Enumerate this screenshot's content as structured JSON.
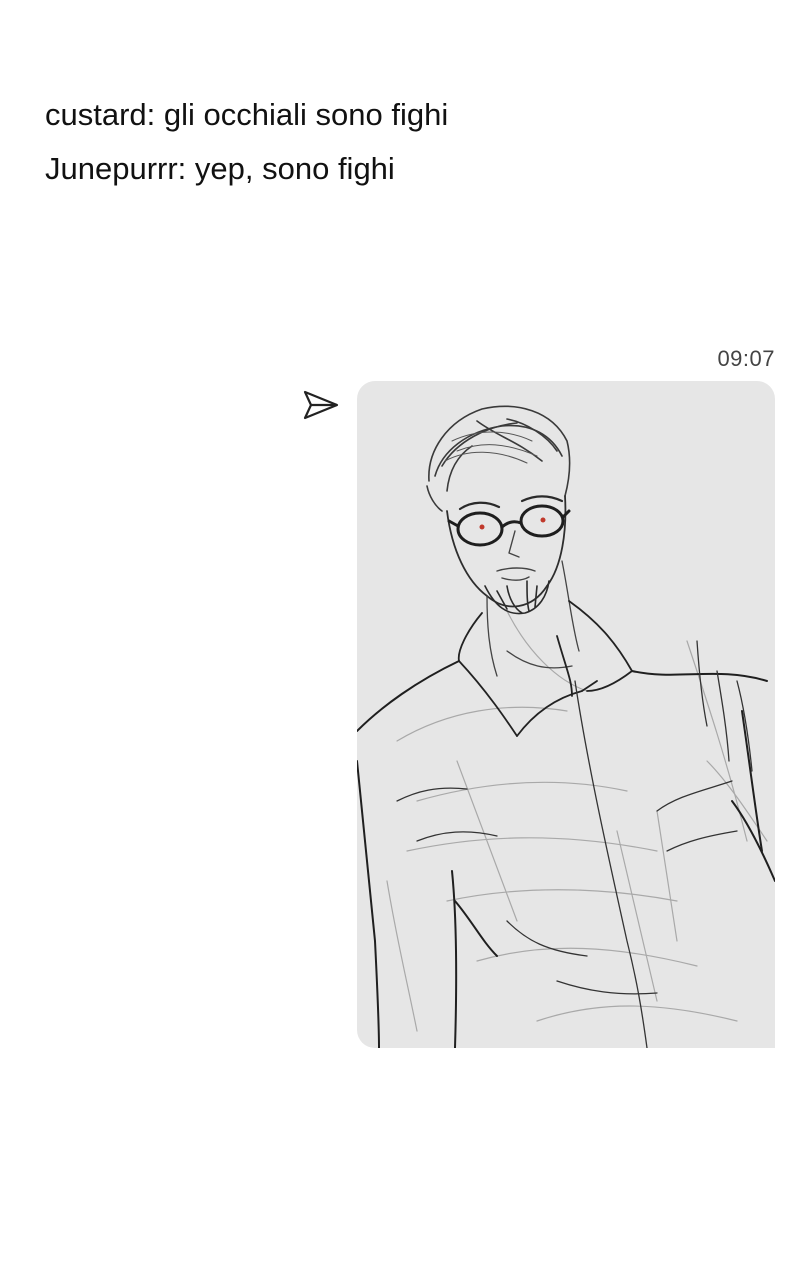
{
  "caption": {
    "lines": [
      "custard: gli occhiali sono fighi",
      "Junepurrr: yep, sono fighi"
    ]
  },
  "message": {
    "timestamp": "09:07",
    "status_icon": "paper-plane-icon",
    "attachment": {
      "type": "image",
      "subject": "pencil sketch of a bearded man with round glasses and a collared shirt",
      "background_color": "#e6e6e6"
    }
  }
}
